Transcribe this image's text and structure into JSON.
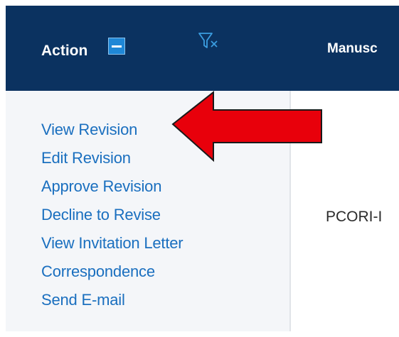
{
  "header": {
    "action_label": "Action",
    "manuscript_label": "Manusc",
    "background": "#0b3260",
    "collapse_icon": "minus-square-icon",
    "filter_icon": "filter-clear-icon"
  },
  "actions": [
    {
      "label": "View Revision"
    },
    {
      "label": "Edit Revision"
    },
    {
      "label": "Approve Revision"
    },
    {
      "label": "Decline to Revise"
    },
    {
      "label": "View Invitation Letter"
    },
    {
      "label": "Correspondence"
    },
    {
      "label": "Send E-mail"
    }
  ],
  "row": {
    "manuscript_value": "PCORI-I"
  },
  "annotation": {
    "arrow_color": "#e8000b",
    "arrow_icon": "left-arrow-icon",
    "points_to": "View Revision"
  },
  "colors": {
    "link": "#1a6fbf",
    "accent_button": "#1f87d6"
  }
}
